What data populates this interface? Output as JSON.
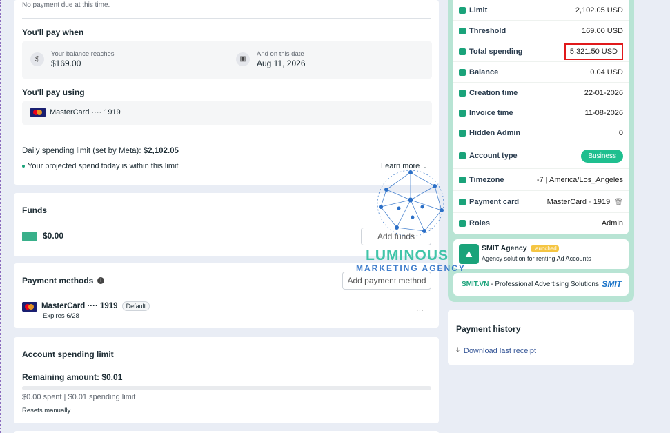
{
  "summary": {
    "no_payment": "No payment due at this time.",
    "pay_when_title": "You'll pay when",
    "balance_label": "Your balance reaches",
    "balance_value": "$169.00",
    "date_label": "And on this date",
    "date_value": "Aug 11, 2026",
    "pay_using_title": "You'll pay using",
    "card_label": "MasterCard ···· 1919",
    "daily_limit_prefix": "Daily spending limit (set by Meta):",
    "daily_limit_value": "$2,102.05",
    "projected_note": "Your projected spend today is within this limit",
    "learn_more": "Learn more"
  },
  "funds": {
    "title": "Funds",
    "amount": "$0.00",
    "add_funds": "Add funds"
  },
  "payment_methods": {
    "title": "Payment methods",
    "add_button": "Add payment method",
    "card_label": "MasterCard ···· 1919",
    "default_badge": "Default",
    "expires": "Expires 6/28",
    "more": "···"
  },
  "spending_limit": {
    "title": "Account spending limit",
    "remaining": "Remaining amount: $0.01",
    "detail": "$0.00 spent | $0.01 spending limit",
    "resets": "Resets manually",
    "progress_fraction": 0
  },
  "account_info": [
    {
      "label": "Limit",
      "value": "2,102.05 USD"
    },
    {
      "label": "Threshold",
      "value": "169.00 USD"
    },
    {
      "label": "Total spending",
      "value": "5,321.50 USD"
    },
    {
      "label": "Balance",
      "value": "0.04 USD"
    },
    {
      "label": "Creation time",
      "value": "22-01-2026"
    },
    {
      "label": "Invoice time",
      "value": "11-08-2026"
    },
    {
      "label": "Hidden Admin",
      "value": "0"
    },
    {
      "label": "Account type",
      "value": "Business"
    },
    {
      "label": "Timezone",
      "value": "-7 | America/Los_Angeles"
    },
    {
      "label": "Payment card",
      "value": "MasterCard · 1919"
    },
    {
      "label": "Roles",
      "value": "Admin"
    }
  ],
  "smit_agency": {
    "name": "SMIT Agency",
    "badge": "Launched",
    "desc": "Agency solution for renting Ad Accounts"
  },
  "smit_vn": {
    "brand": "SMIT.VN",
    "text": " - Professional Advertising Solutions",
    "logo": "SMIT"
  },
  "watermark": {
    "line1": "LUMINOUS",
    "line2": "MARKETING AGENCY"
  },
  "payment_history": {
    "title": "Payment history",
    "download": "Download last receipt"
  },
  "colors": {
    "accent_green": "#1aa37a",
    "highlight_red": "#e0191b",
    "link_blue": "#385898"
  }
}
